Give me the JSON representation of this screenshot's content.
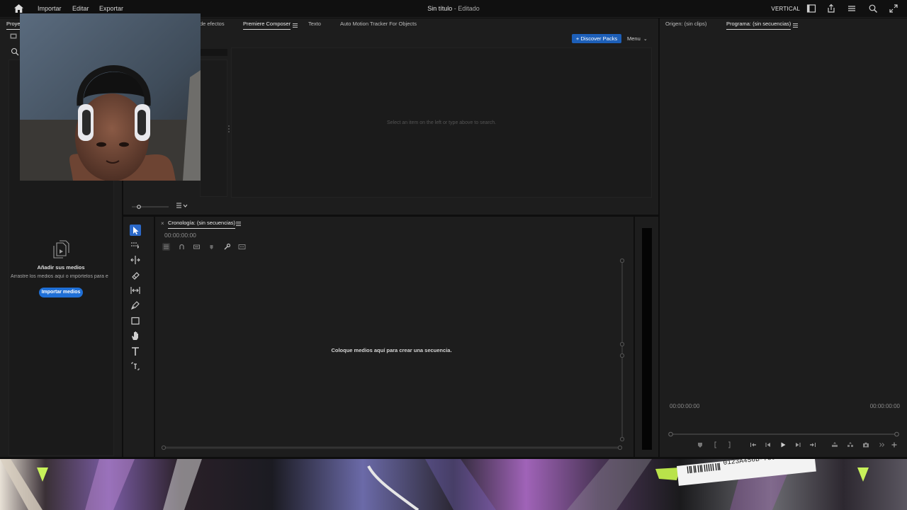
{
  "app": {
    "document_title": "Sin título",
    "document_status": "- Editado",
    "menu": [
      "Importar",
      "Editar",
      "Exportar"
    ],
    "workspace": "VERTICAL"
  },
  "project_panel": {
    "tab": "Proye",
    "empty_title": "Añadir sus medios",
    "empty_desc": "Arrastre los medios aquí o impórtelos para e",
    "import_button": "Importar medios"
  },
  "composer_panel": {
    "tabs": [
      "de efectos",
      "Premiere Composer",
      "Texto",
      "Auto Motion Tracker For Objects"
    ],
    "discover_button": "+ Discover Packs",
    "menu_label": "Menu",
    "hint": "Select an item on the left or type above to search."
  },
  "timeline": {
    "title": "Cronología: (sin secuencias)",
    "timecode": "00:00:00:00",
    "empty_message": "Coloque medios aquí para crear una secuencia."
  },
  "program_monitor": {
    "tabs": [
      "Origen: (sin clips)",
      "Programa: (sin secuencias)"
    ],
    "timecode_left": "00:00:00:00",
    "timecode_right": "00:00:00:00"
  },
  "wallpaper": {
    "sticker_text": "0123A456B-789"
  },
  "colors": {
    "accent": "#1f6fd6",
    "panel": "#1d1d1d",
    "background": "#0e0e0e"
  }
}
